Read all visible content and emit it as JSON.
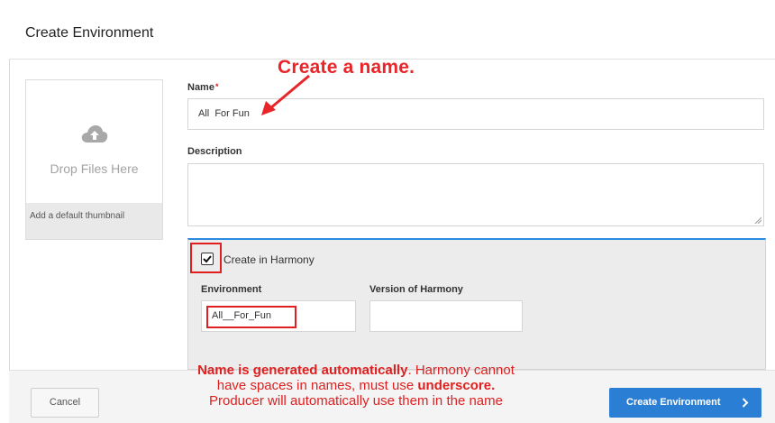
{
  "dialog": {
    "title": "Create Environment"
  },
  "thumbnail": {
    "drop_text": "Drop Files Here",
    "footer_text": "Add a default thumbnail",
    "icon": "cloud-upload-icon"
  },
  "form": {
    "name_label": "Name",
    "required_mark": "*",
    "name_value": "All  For Fun",
    "description_label": "Description",
    "description_value": ""
  },
  "harmony": {
    "checkbox_checked": true,
    "checkbox_label": "Create in Harmony",
    "environment_label": "Environment",
    "environment_value": "All__For_Fun",
    "version_label": "Version of Harmony",
    "version_value": ""
  },
  "footer": {
    "cancel_label": "Cancel",
    "create_label": "Create Environment",
    "create_icon": "chevron-right-icon"
  },
  "annotations": {
    "title": "Create a name.",
    "note_bold_1": "Name is generated automatically",
    "note_text_1": ". Harmony cannot",
    "note_text_2": "have spaces in names, must use ",
    "note_bold_2": "underscore.",
    "note_text_3": "Producer will automatically use them in the name"
  },
  "colors": {
    "accent": "#2a7fd4",
    "annotation": "#e02020",
    "panel": "#ececec"
  }
}
